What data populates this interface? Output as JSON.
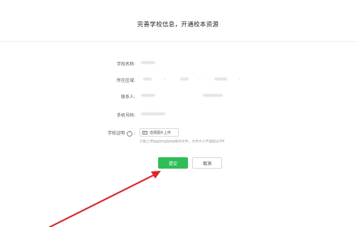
{
  "header": {
    "title": "完善学校信息，开通校本资源"
  },
  "form": {
    "school_name_label": "学校名称:",
    "region_label": "所在区域:",
    "contact_label": "联系人:",
    "phone_label": "手机号码:",
    "certificate_label": "学校证明",
    "certificate_help": "?",
    "certificate_colon": ":",
    "upload_label": "选择图片上传",
    "upload_hint": "只能上传jpg/png/jpeg格式文件，文件大小不能超过1M",
    "select_chevron": "⌄"
  },
  "actions": {
    "submit_label": "提交",
    "cancel_label": "取消"
  },
  "colors": {
    "primary": "#2fbe55",
    "annotation_arrow": "#d9262c"
  },
  "icons": {
    "upload": "image-icon",
    "help": "help-circle-icon"
  }
}
